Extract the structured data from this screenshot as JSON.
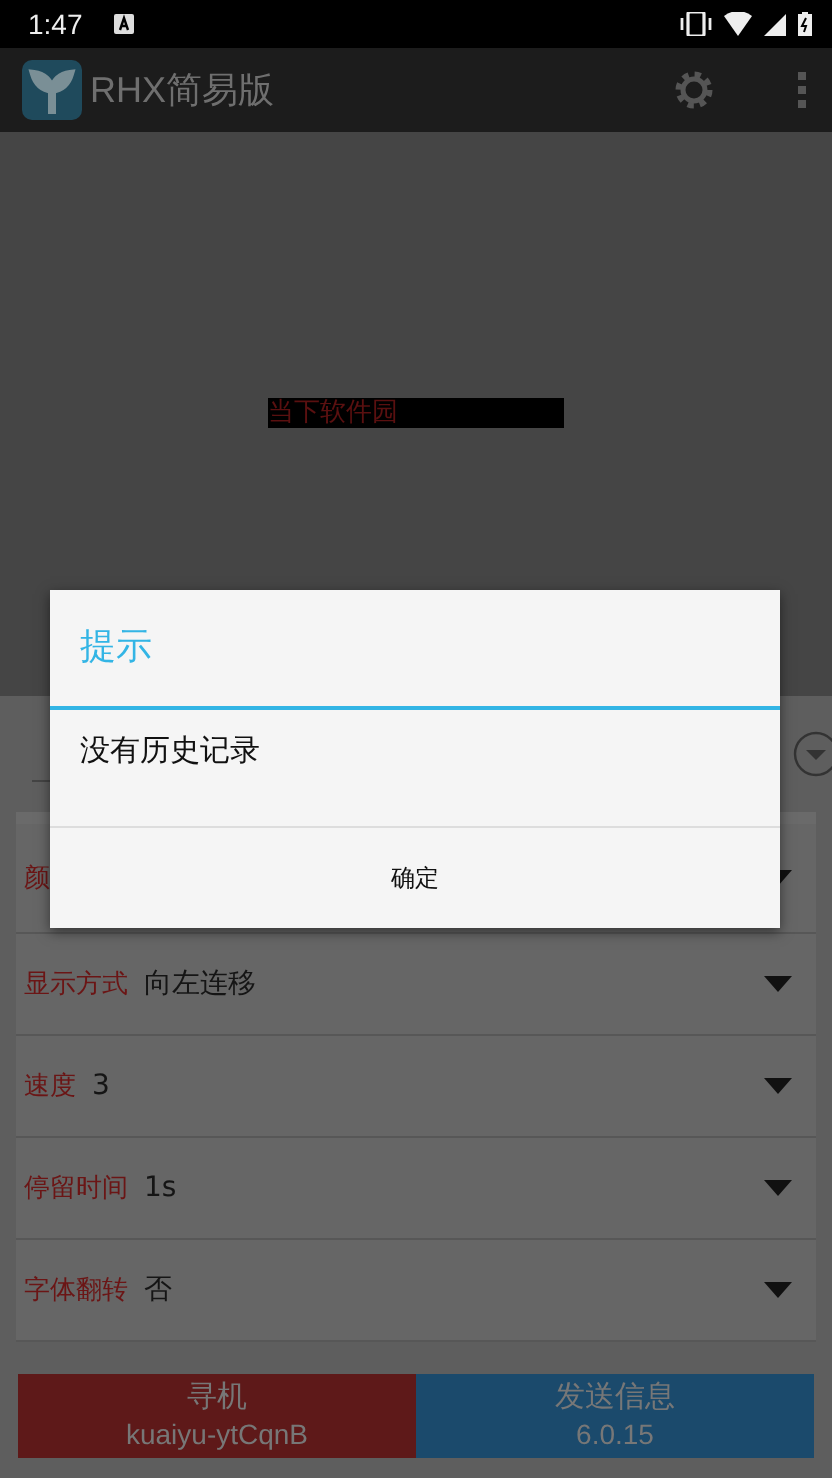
{
  "status_bar": {
    "time": "1:47"
  },
  "app_bar": {
    "title": "RHX简易版"
  },
  "preview": {
    "marquee_text": "当下软件园"
  },
  "form": {
    "settings": [
      {
        "label": "颜"
      },
      {
        "label": "显示方式",
        "value": "向左连移"
      },
      {
        "label": "速度",
        "value": "3"
      },
      {
        "label": "停留时间",
        "value": "1s"
      },
      {
        "label": "字体翻转",
        "value": "否"
      }
    ]
  },
  "buttons": [
    {
      "title": "寻机",
      "subtitle": "kuaiyu-ytCqnB",
      "color": "#5e1919"
    },
    {
      "title": "发送信息",
      "subtitle": "6.0.15",
      "color": "#1b4a6c"
    }
  ],
  "dialog": {
    "title": "提示",
    "message": "没有历史记录",
    "button": "确定"
  }
}
